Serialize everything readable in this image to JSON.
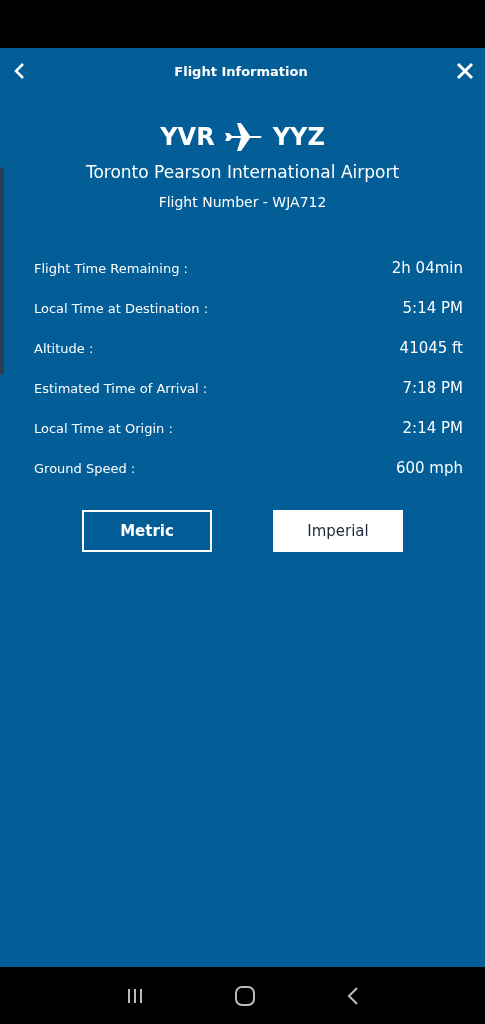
{
  "header": {
    "title": "Flight Information"
  },
  "route": {
    "origin": "YVR",
    "destination": "YYZ",
    "airport": "Toronto Pearson International Airport",
    "flight_number": "Flight Number - WJA712"
  },
  "details": [
    {
      "label": "Flight Time Remaining :",
      "value": "2h 04min"
    },
    {
      "label": "Local Time at Destination :",
      "value": "5:14 PM"
    },
    {
      "label": "Altitude :",
      "value": "41045 ft"
    },
    {
      "label": "Estimated Time of Arrival :",
      "value": "7:18 PM"
    },
    {
      "label": "Local Time at Origin :",
      "value": "2:14 PM"
    },
    {
      "label": "Ground Speed :",
      "value": "600 mph"
    }
  ],
  "units": [
    {
      "label": "Metric",
      "selected": false
    },
    {
      "label": "Imperial",
      "selected": true
    }
  ]
}
